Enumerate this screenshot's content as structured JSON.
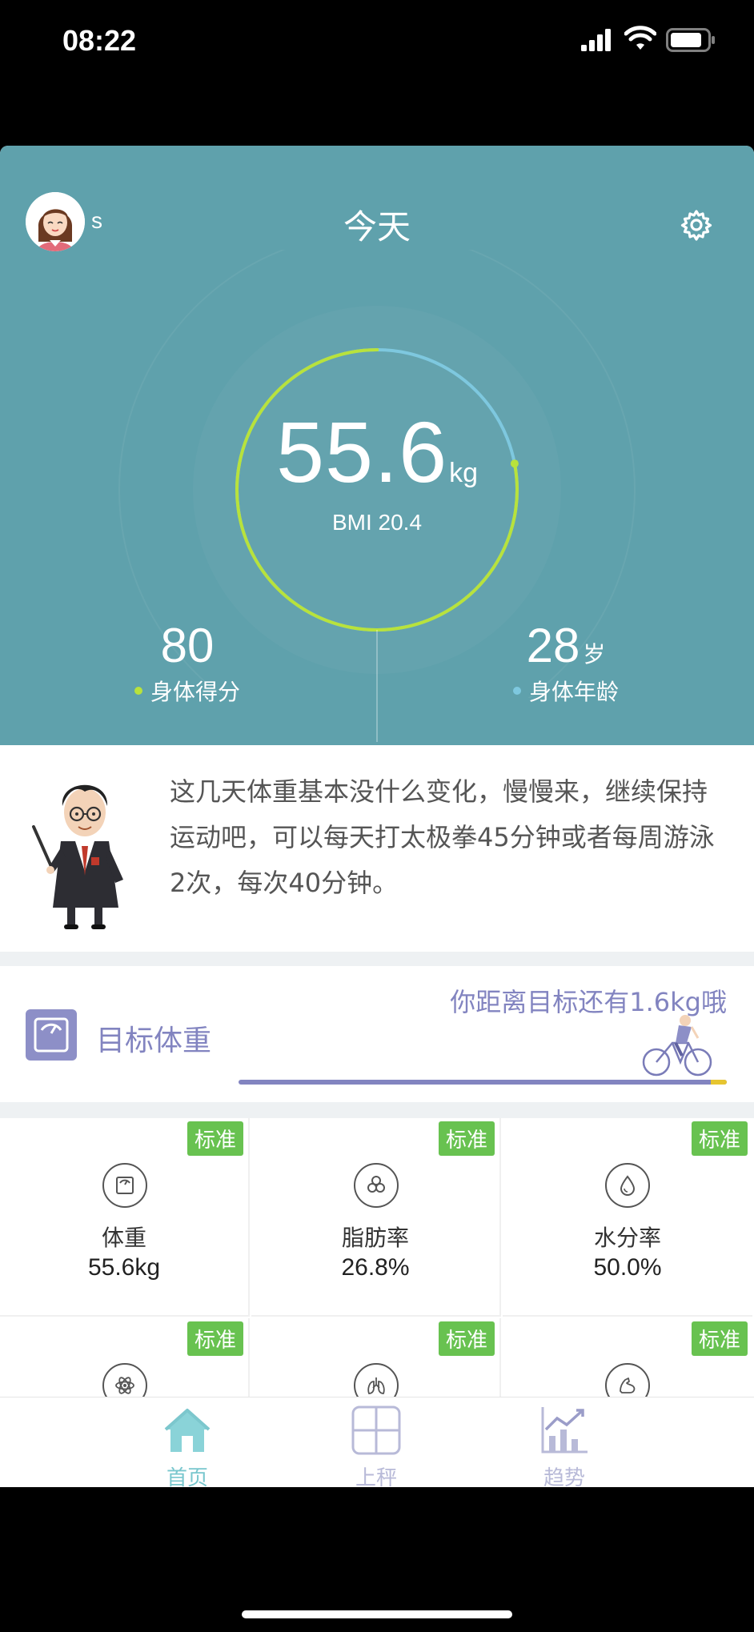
{
  "status_bar": {
    "time": "08:22"
  },
  "header": {
    "username": "s",
    "title": "今天"
  },
  "summary": {
    "weight_value": "55.6",
    "weight_unit": "kg",
    "bmi": "BMI 20.4",
    "gauge_progress": 0.78,
    "body_score": {
      "value": "80",
      "label": "身体得分"
    },
    "body_age": {
      "value": "28",
      "suffix": "岁",
      "label": "身体年龄"
    }
  },
  "advice": {
    "text": "这几天体重基本没什么变化，慢慢来，继续保持运动吧，可以每天打太极拳45分钟或者每周游泳2次，每次40分钟。"
  },
  "goal": {
    "title": "目标体重",
    "hint": "你距离目标还有1.6kg哦"
  },
  "metrics": [
    {
      "badge": "标准",
      "name": "体重",
      "value": "55.6kg",
      "icon": "scale-icon"
    },
    {
      "badge": "标准",
      "name": "脂肪率",
      "value": "26.8%",
      "icon": "fat-cells-icon"
    },
    {
      "badge": "标准",
      "name": "水分率",
      "value": "50.0%",
      "icon": "water-drop-icon"
    },
    {
      "badge": "标准",
      "name": "",
      "value": "",
      "icon": "atom-icon"
    },
    {
      "badge": "标准",
      "name": "",
      "value": "",
      "icon": "lungs-icon"
    },
    {
      "badge": "标准",
      "name": "",
      "value": "",
      "icon": "muscle-icon"
    }
  ],
  "tabs": [
    {
      "label": "首页",
      "icon": "home-icon",
      "active": true
    },
    {
      "label": "上秤",
      "icon": "scale-grid-icon",
      "active": false
    },
    {
      "label": "趋势",
      "icon": "trend-chart-icon",
      "active": false
    }
  ],
  "colors": {
    "hero_bg": "#5fa1ac",
    "gauge_green": "#b8e23c",
    "gauge_blue": "#7ec8df",
    "accent_purple": "#8284c0",
    "badge_green": "#68c250",
    "tab_active": "#79c7ce"
  }
}
